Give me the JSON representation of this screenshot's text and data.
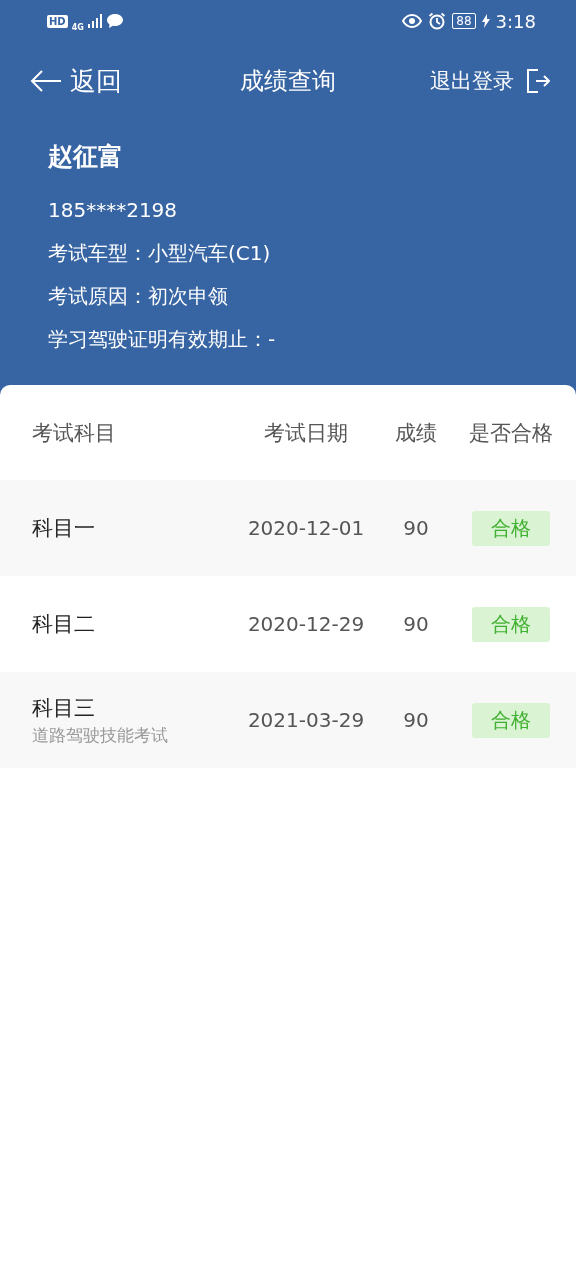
{
  "status_bar": {
    "hd": "HD",
    "network": "4G",
    "battery": "88",
    "time": "3:18"
  },
  "nav": {
    "back": "返回",
    "title": "成绩查询",
    "logout": "退出登录"
  },
  "profile": {
    "name": "赵征富",
    "phone": "185****2198",
    "lines": [
      "考试车型：小型汽车(C1)",
      "考试原因：初次申领",
      "学习驾驶证明有效期止：-"
    ]
  },
  "table": {
    "columns": [
      "考试科目",
      "考试日期",
      "成绩",
      "是否合格"
    ],
    "rows": [
      {
        "subject": "科目一",
        "date": "2020-12-01",
        "score": "90",
        "result": "合格",
        "passed": true
      },
      {
        "subject": "科目二",
        "date": "2020-12-29",
        "score": "90",
        "result": "合格",
        "passed": true
      },
      {
        "subject": "科目三",
        "note": "道路驾驶技能考试",
        "date": "2021-03-29",
        "score": "90",
        "result": "合格",
        "passed": true
      }
    ]
  }
}
